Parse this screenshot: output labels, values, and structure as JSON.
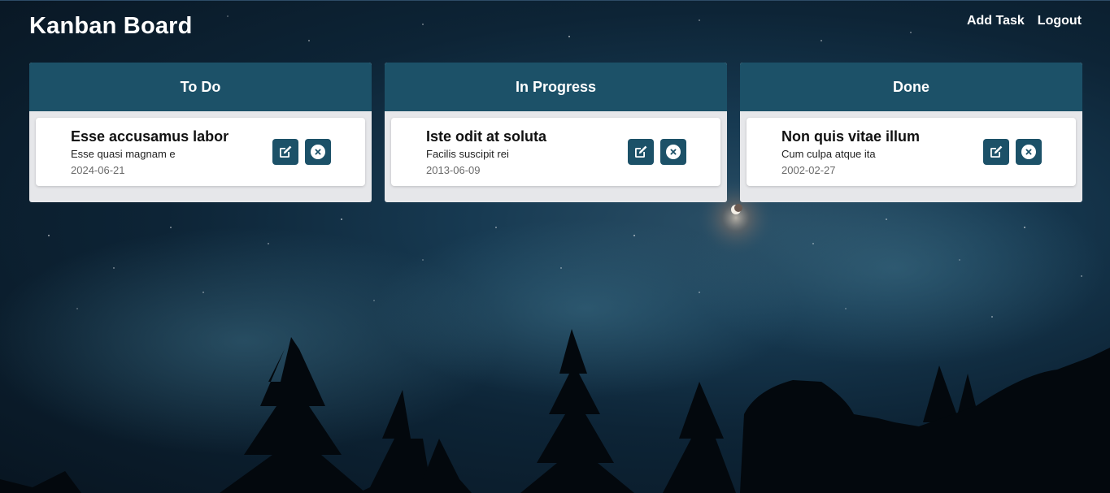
{
  "header": {
    "title": "Kanban Board",
    "nav": [
      {
        "label": "Add Task"
      },
      {
        "label": "Logout"
      }
    ]
  },
  "columns": [
    {
      "title": "To Do",
      "tasks": [
        {
          "title": "Esse accusamus labor",
          "description": "Esse quasi magnam e",
          "date": "2024-06-21"
        }
      ]
    },
    {
      "title": "In Progress",
      "tasks": [
        {
          "title": "Iste odit at soluta",
          "description": "Facilis suscipit rei",
          "date": "2013-06-09"
        }
      ]
    },
    {
      "title": "Done",
      "tasks": [
        {
          "title": "Non quis vitae illum",
          "description": "Cum culpa atque ita",
          "date": "2002-02-27"
        }
      ]
    }
  ],
  "icons": {
    "edit": "edit-icon",
    "delete": "close-circle-icon"
  },
  "colors": {
    "accent": "#1c5168",
    "column_background": "#e6e7ea",
    "card_background": "#ffffff"
  }
}
